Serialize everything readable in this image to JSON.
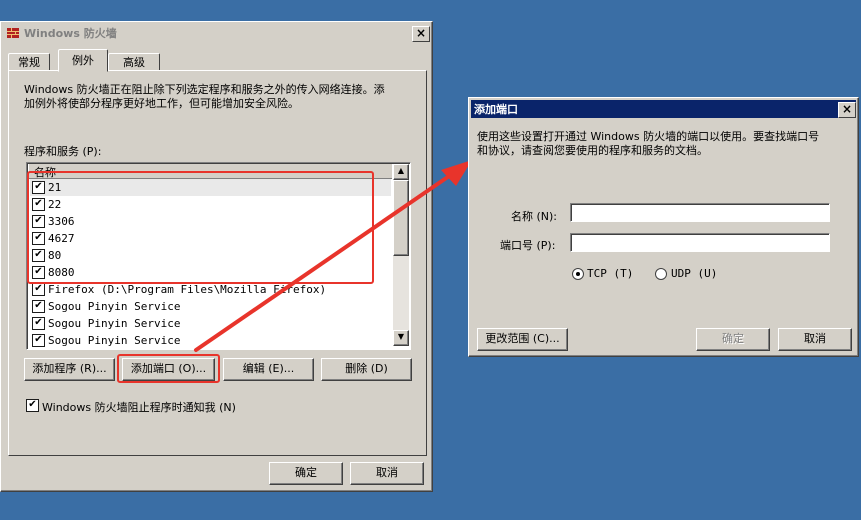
{
  "main_window": {
    "title": "Windows 防火墙",
    "tabs": [
      {
        "label": "常规"
      },
      {
        "label": "例外"
      },
      {
        "label": "高级"
      }
    ],
    "description_line1": "Windows 防火墙正在阻止除下列选定程序和服务之外的传入网络连接。添",
    "description_line2": "加例外将使部分程序更好地工作，但可能增加安全风险。",
    "list_label": "程序和服务 (P):",
    "column_header": "名称",
    "items": [
      {
        "label": "21",
        "checked": true
      },
      {
        "label": "22",
        "checked": true
      },
      {
        "label": "3306",
        "checked": true
      },
      {
        "label": "4627",
        "checked": true
      },
      {
        "label": "80",
        "checked": true
      },
      {
        "label": "8080",
        "checked": true
      },
      {
        "label": "Firefox (D:\\Program Files\\Mozilla Firefox)",
        "checked": true
      },
      {
        "label": "Sogou Pinyin Service",
        "checked": true
      },
      {
        "label": "Sogou Pinyin Service",
        "checked": true
      },
      {
        "label": "Sogou Pinyin Service",
        "checked": true
      }
    ],
    "buttons": {
      "add_program": "添加程序 (R)...",
      "add_port": "添加端口 (O)...",
      "edit": "编辑 (E)...",
      "delete": "删除 (D)"
    },
    "notify_label": "Windows 防火墙阻止程序时通知我 (N)",
    "notify_checked": true,
    "ok": "确定",
    "cancel": "取消"
  },
  "add_port_dialog": {
    "title": "添加端口",
    "description_line1": "使用这些设置打开通过 Windows 防火墙的端口以使用。要查找端口号",
    "description_line2": "和协议，请查阅您要使用的程序和服务的文档。",
    "name_label": "名称 (N):",
    "name_value": "",
    "port_label": "端口号 (P):",
    "port_value": "",
    "tcp_label": "TCP (T)",
    "udp_label": "UDP (U)",
    "selected_protocol": "TCP",
    "change_scope": "更改范围 (C)...",
    "ok": "确定",
    "cancel": "取消"
  },
  "colors": {
    "desktop": "#3a6ea5",
    "active_title": "#0a246a",
    "inactive_title": "#d4d0c8",
    "highlight": "#e8342b"
  }
}
